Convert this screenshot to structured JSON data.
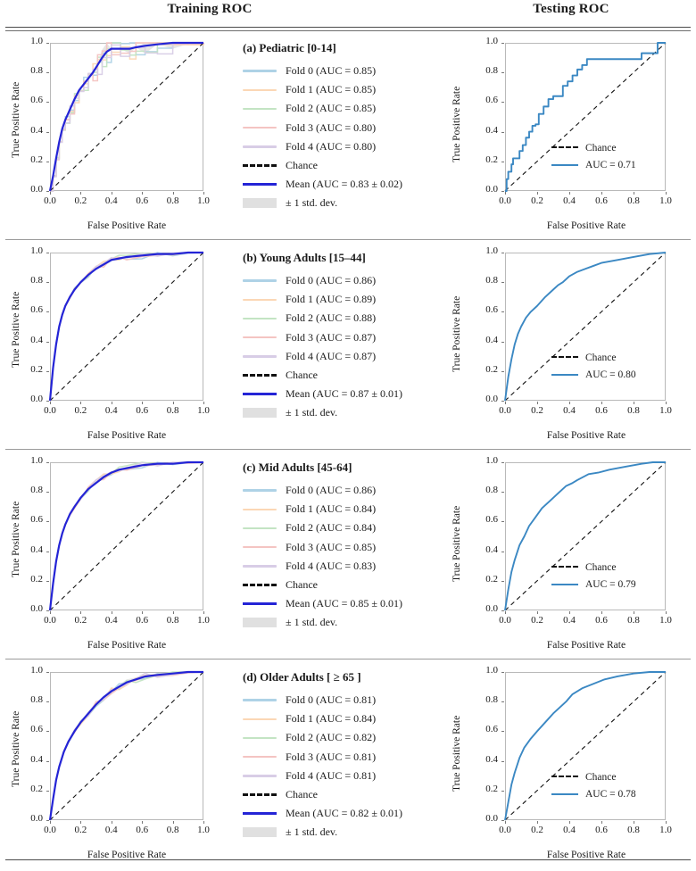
{
  "header": {
    "training_title": "Training ROC",
    "testing_title": "Testing ROC"
  },
  "axis": {
    "xlabel": "False Positive Rate",
    "ylabel": "True Positive Rate",
    "xticks": [
      "0.0",
      "0.2",
      "0.4",
      "0.6",
      "0.8",
      "1.0"
    ],
    "yticks": [
      "0.0",
      "0.2",
      "0.4",
      "0.6",
      "0.8",
      "1.0"
    ],
    "xlim": [
      0.0,
      1.0
    ],
    "ylim": [
      0.0,
      1.0
    ]
  },
  "legend_labels": {
    "chance": "Chance",
    "std_band": "± 1 std. dev."
  },
  "colors": {
    "fold0": "#aed2e6",
    "fold1": "#fbd7b5",
    "fold2": "#c3e4c3",
    "fold3": "#f4c4c2",
    "fold4": "#d8cde6",
    "mean": "#2424d6",
    "chance": "#111111",
    "band": "#e0e0e0",
    "test_curve": "#3b88c3",
    "axes_border": "#b9b9b9"
  },
  "panels": [
    {
      "id": "a",
      "title": "(a) Pediatric [0-14]",
      "folds": [
        {
          "label": "Fold 0 (AUC = 0.85)",
          "auc": 0.85
        },
        {
          "label": "Fold 1 (AUC = 0.85)",
          "auc": 0.85
        },
        {
          "label": "Fold 2 (AUC = 0.85)",
          "auc": 0.85
        },
        {
          "label": "Fold 3 (AUC = 0.80)",
          "auc": 0.8
        },
        {
          "label": "Fold 4 (AUC = 0.80)",
          "auc": 0.8
        }
      ],
      "mean_label": "Mean (AUC = 0.83 ± 0.02)",
      "mean_auc": 0.83,
      "mean_std": 0.02,
      "test_label": "AUC = 0.71",
      "test_auc": 0.71
    },
    {
      "id": "b",
      "title": "(b) Young Adults [15–44]",
      "folds": [
        {
          "label": "Fold 0 (AUC = 0.86)",
          "auc": 0.86
        },
        {
          "label": "Fold 1 (AUC = 0.89)",
          "auc": 0.89
        },
        {
          "label": "Fold 2 (AUC = 0.88)",
          "auc": 0.88
        },
        {
          "label": "Fold 3 (AUC = 0.87)",
          "auc": 0.87
        },
        {
          "label": "Fold 4 (AUC = 0.87)",
          "auc": 0.87
        }
      ],
      "mean_label": "Mean (AUC = 0.87 ± 0.01)",
      "mean_auc": 0.87,
      "mean_std": 0.01,
      "test_label": "AUC = 0.80",
      "test_auc": 0.8
    },
    {
      "id": "c",
      "title": "(c) Mid Adults [45-64]",
      "folds": [
        {
          "label": "Fold 0 (AUC = 0.86)",
          "auc": 0.86
        },
        {
          "label": "Fold 1 (AUC = 0.84)",
          "auc": 0.84
        },
        {
          "label": "Fold 2 (AUC = 0.84)",
          "auc": 0.84
        },
        {
          "label": "Fold 3 (AUC = 0.85)",
          "auc": 0.85
        },
        {
          "label": "Fold 4 (AUC = 0.83)",
          "auc": 0.83
        }
      ],
      "mean_label": "Mean (AUC = 0.85 ± 0.01)",
      "mean_auc": 0.85,
      "mean_std": 0.01,
      "test_label": "AUC = 0.79",
      "test_auc": 0.79
    },
    {
      "id": "d",
      "title": "(d) Older Adults [ ≥ 65 ]",
      "folds": [
        {
          "label": "Fold 0 (AUC = 0.81)",
          "auc": 0.81
        },
        {
          "label": "Fold 1 (AUC = 0.84)",
          "auc": 0.84
        },
        {
          "label": "Fold 2 (AUC = 0.82)",
          "auc": 0.82
        },
        {
          "label": "Fold 3 (AUC = 0.81)",
          "auc": 0.81
        },
        {
          "label": "Fold 4 (AUC = 0.81)",
          "auc": 0.81
        }
      ],
      "mean_label": "Mean (AUC = 0.82 ± 0.01)",
      "mean_auc": 0.82,
      "mean_std": 0.01,
      "test_label": "AUC = 0.78",
      "test_auc": 0.78
    }
  ],
  "chart_data": [
    {
      "type": "line",
      "panel": "a-train",
      "title": "(a) Pediatric [0-14] — Training ROC",
      "xlabel": "False Positive Rate",
      "ylabel": "True Positive Rate",
      "xlim": [
        0.0,
        1.0
      ],
      "ylim": [
        0.0,
        1.0
      ],
      "grid": false,
      "legend_position": "outside-right",
      "series": [
        {
          "name": "Mean (AUC = 0.83 ± 0.02)",
          "x": [
            0.0,
            0.02,
            0.04,
            0.06,
            0.08,
            0.1,
            0.13,
            0.16,
            0.19,
            0.22,
            0.25,
            0.28,
            0.31,
            0.34,
            0.37,
            0.4,
            0.46,
            0.52,
            0.56,
            0.62,
            0.7,
            0.8,
            0.9,
            1.0
          ],
          "y": [
            0.0,
            0.1,
            0.22,
            0.33,
            0.42,
            0.48,
            0.55,
            0.62,
            0.68,
            0.72,
            0.76,
            0.8,
            0.85,
            0.9,
            0.94,
            0.96,
            0.96,
            0.96,
            0.97,
            0.98,
            0.99,
            1.0,
            1.0,
            1.0
          ]
        },
        {
          "name": "Chance",
          "x": [
            0.0,
            1.0
          ],
          "y": [
            0.0,
            1.0
          ]
        }
      ]
    },
    {
      "type": "line",
      "panel": "a-test",
      "title": "(a) Pediatric [0-14] — Testing ROC (AUC = 0.71)",
      "xlabel": "False Positive Rate",
      "ylabel": "True Positive Rate",
      "xlim": [
        0.0,
        1.0
      ],
      "ylim": [
        0.0,
        1.0
      ],
      "grid": false,
      "legend_position": "lower-right",
      "series": [
        {
          "name": "AUC = 0.71",
          "x": [
            0.0,
            0.01,
            0.02,
            0.04,
            0.05,
            0.07,
            0.09,
            0.11,
            0.13,
            0.15,
            0.17,
            0.19,
            0.21,
            0.24,
            0.27,
            0.3,
            0.33,
            0.36,
            0.39,
            0.42,
            0.45,
            0.48,
            0.51,
            0.52,
            0.7,
            0.83,
            0.85,
            0.93,
            0.95,
            1.0
          ],
          "y": [
            0.0,
            0.08,
            0.13,
            0.18,
            0.22,
            0.22,
            0.27,
            0.31,
            0.36,
            0.4,
            0.44,
            0.45,
            0.52,
            0.57,
            0.62,
            0.64,
            0.64,
            0.71,
            0.74,
            0.78,
            0.82,
            0.85,
            0.89,
            0.89,
            0.89,
            0.89,
            0.93,
            0.93,
            1.0,
            1.0
          ]
        },
        {
          "name": "Chance",
          "x": [
            0.0,
            1.0
          ],
          "y": [
            0.0,
            1.0
          ]
        }
      ]
    },
    {
      "type": "line",
      "panel": "b-train",
      "title": "(b) Young Adults [15–44] — Training ROC",
      "xlabel": "False Positive Rate",
      "ylabel": "True Positive Rate",
      "xlim": [
        0.0,
        1.0
      ],
      "ylim": [
        0.0,
        1.0
      ],
      "grid": false,
      "legend_position": "outside-right",
      "series": [
        {
          "name": "Mean (AUC = 0.87 ± 0.01)",
          "x": [
            0.0,
            0.02,
            0.04,
            0.06,
            0.08,
            0.1,
            0.13,
            0.16,
            0.2,
            0.25,
            0.3,
            0.35,
            0.4,
            0.45,
            0.5,
            0.6,
            0.7,
            0.8,
            0.9,
            1.0
          ],
          "y": [
            0.0,
            0.22,
            0.38,
            0.5,
            0.58,
            0.64,
            0.7,
            0.75,
            0.8,
            0.85,
            0.89,
            0.92,
            0.95,
            0.96,
            0.97,
            0.98,
            0.99,
            0.99,
            1.0,
            1.0
          ]
        },
        {
          "name": "Chance",
          "x": [
            0.0,
            1.0
          ],
          "y": [
            0.0,
            1.0
          ]
        }
      ]
    },
    {
      "type": "line",
      "panel": "b-test",
      "title": "(b) Young Adults [15–44] — Testing ROC (AUC = 0.80)",
      "xlabel": "False Positive Rate",
      "ylabel": "True Positive Rate",
      "xlim": [
        0.0,
        1.0
      ],
      "ylim": [
        0.0,
        1.0
      ],
      "grid": false,
      "legend_position": "lower-right",
      "series": [
        {
          "name": "AUC = 0.80",
          "x": [
            0.0,
            0.02,
            0.04,
            0.06,
            0.08,
            0.1,
            0.13,
            0.16,
            0.2,
            0.25,
            0.3,
            0.33,
            0.36,
            0.4,
            0.45,
            0.5,
            0.55,
            0.6,
            0.7,
            0.8,
            0.9,
            1.0
          ],
          "y": [
            0.0,
            0.16,
            0.28,
            0.38,
            0.45,
            0.5,
            0.56,
            0.6,
            0.64,
            0.7,
            0.75,
            0.78,
            0.8,
            0.84,
            0.87,
            0.89,
            0.91,
            0.93,
            0.95,
            0.97,
            0.99,
            1.0
          ]
        },
        {
          "name": "Chance",
          "x": [
            0.0,
            1.0
          ],
          "y": [
            0.0,
            1.0
          ]
        }
      ]
    },
    {
      "type": "line",
      "panel": "c-train",
      "title": "(c) Mid Adults [45-64] — Training ROC",
      "xlabel": "False Positive Rate",
      "ylabel": "True Positive Rate",
      "xlim": [
        0.0,
        1.0
      ],
      "ylim": [
        0.0,
        1.0
      ],
      "grid": false,
      "legend_position": "outside-right",
      "series": [
        {
          "name": "Mean (AUC = 0.85 ± 0.01)",
          "x": [
            0.0,
            0.02,
            0.04,
            0.06,
            0.08,
            0.1,
            0.13,
            0.16,
            0.2,
            0.25,
            0.3,
            0.35,
            0.4,
            0.45,
            0.5,
            0.6,
            0.7,
            0.8,
            0.9,
            1.0
          ],
          "y": [
            0.0,
            0.18,
            0.33,
            0.44,
            0.52,
            0.58,
            0.65,
            0.7,
            0.76,
            0.82,
            0.86,
            0.9,
            0.93,
            0.95,
            0.96,
            0.98,
            0.99,
            0.99,
            1.0,
            1.0
          ]
        },
        {
          "name": "Chance",
          "x": [
            0.0,
            1.0
          ],
          "y": [
            0.0,
            1.0
          ]
        }
      ]
    },
    {
      "type": "line",
      "panel": "c-test",
      "title": "(c) Mid Adults [45-64] — Testing ROC (AUC = 0.79)",
      "xlabel": "False Positive Rate",
      "ylabel": "True Positive Rate",
      "xlim": [
        0.0,
        1.0
      ],
      "ylim": [
        0.0,
        1.0
      ],
      "grid": false,
      "legend_position": "lower-right",
      "series": [
        {
          "name": "AUC = 0.79",
          "x": [
            0.0,
            0.02,
            0.04,
            0.06,
            0.09,
            0.12,
            0.15,
            0.19,
            0.23,
            0.28,
            0.33,
            0.38,
            0.42,
            0.45,
            0.52,
            0.58,
            0.65,
            0.75,
            0.85,
            0.92,
            1.0
          ],
          "y": [
            0.0,
            0.14,
            0.26,
            0.34,
            0.44,
            0.5,
            0.57,
            0.63,
            0.69,
            0.74,
            0.79,
            0.84,
            0.86,
            0.88,
            0.92,
            0.93,
            0.95,
            0.97,
            0.99,
            1.0,
            1.0
          ]
        },
        {
          "name": "Chance",
          "x": [
            0.0,
            1.0
          ],
          "y": [
            0.0,
            1.0
          ]
        }
      ]
    },
    {
      "type": "line",
      "panel": "d-train",
      "title": "(d) Older Adults [ ≥ 65 ] — Training ROC",
      "xlabel": "False Positive Rate",
      "ylabel": "True Positive Rate",
      "xlim": [
        0.0,
        1.0
      ],
      "ylim": [
        0.0,
        1.0
      ],
      "grid": false,
      "legend_position": "outside-right",
      "series": [
        {
          "name": "Mean (AUC = 0.82 ± 0.01)",
          "x": [
            0.0,
            0.02,
            0.04,
            0.06,
            0.09,
            0.12,
            0.16,
            0.2,
            0.25,
            0.3,
            0.35,
            0.4,
            0.45,
            0.5,
            0.56,
            0.62,
            0.7,
            0.8,
            0.9,
            1.0
          ],
          "y": [
            0.0,
            0.14,
            0.27,
            0.36,
            0.46,
            0.53,
            0.6,
            0.66,
            0.72,
            0.78,
            0.83,
            0.87,
            0.9,
            0.93,
            0.95,
            0.97,
            0.98,
            0.99,
            1.0,
            1.0
          ]
        },
        {
          "name": "Chance",
          "x": [
            0.0,
            1.0
          ],
          "y": [
            0.0,
            1.0
          ]
        }
      ]
    },
    {
      "type": "line",
      "panel": "d-test",
      "title": "(d) Older Adults [ ≥ 65 ] — Testing ROC (AUC = 0.78)",
      "xlabel": "False Positive Rate",
      "ylabel": "True Positive Rate",
      "xlim": [
        0.0,
        1.0
      ],
      "ylim": [
        0.0,
        1.0
      ],
      "grid": false,
      "legend_position": "lower-right",
      "series": [
        {
          "name": "AUC = 0.78",
          "x": [
            0.0,
            0.02,
            0.04,
            0.06,
            0.09,
            0.12,
            0.16,
            0.2,
            0.25,
            0.3,
            0.35,
            0.38,
            0.42,
            0.48,
            0.55,
            0.62,
            0.7,
            0.8,
            0.9,
            1.0
          ],
          "y": [
            0.0,
            0.12,
            0.24,
            0.32,
            0.42,
            0.49,
            0.55,
            0.6,
            0.66,
            0.72,
            0.77,
            0.8,
            0.85,
            0.89,
            0.92,
            0.95,
            0.97,
            0.99,
            1.0,
            1.0
          ]
        },
        {
          "name": "Chance",
          "x": [
            0.0,
            1.0
          ],
          "y": [
            0.0,
            1.0
          ]
        }
      ]
    }
  ]
}
